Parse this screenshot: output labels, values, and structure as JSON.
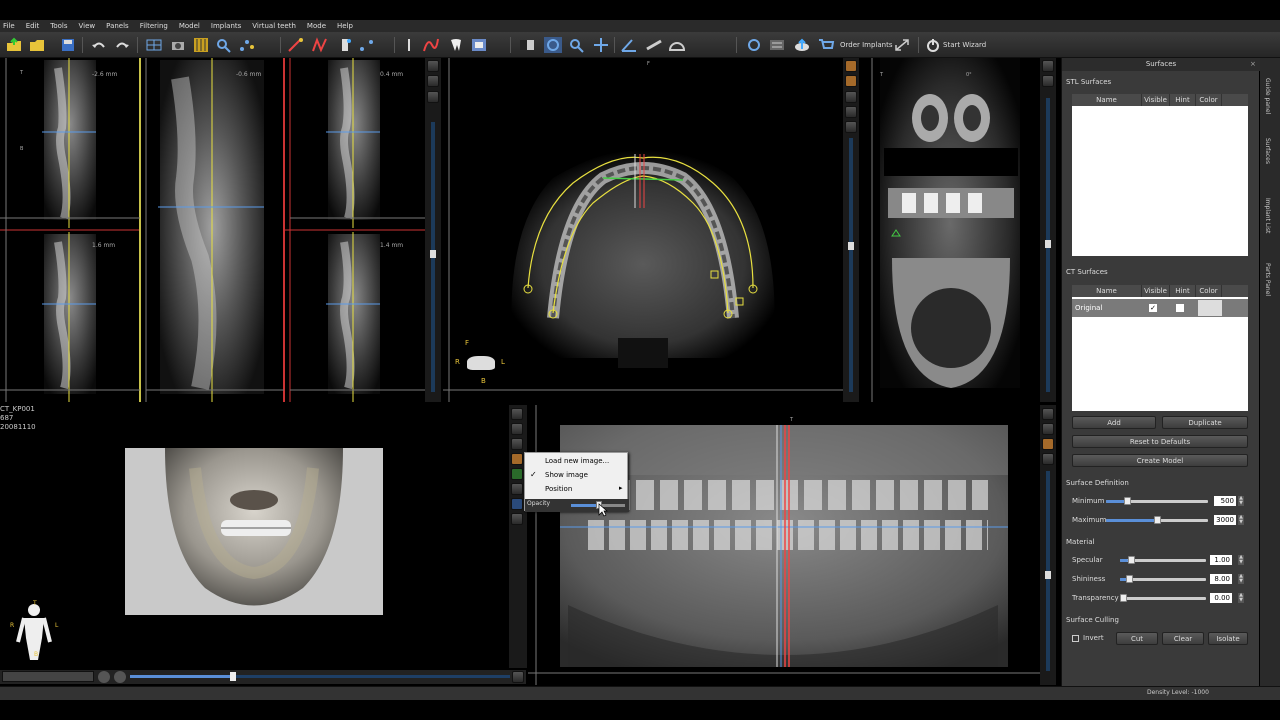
{
  "menu": [
    "File",
    "Edit",
    "Tools",
    "View",
    "Panels",
    "Filtering",
    "Model",
    "Implants",
    "Virtual teeth",
    "Mode",
    "Help"
  ],
  "toolbar": {
    "order_implants": "Order Implants",
    "start_wizard": "Start Wizard"
  },
  "views": {
    "top_left_mm1": "-2.6 mm",
    "top_left_mm2": "-0.6 mm",
    "top_left_mm3": "0.4 mm",
    "bottom_left_mm1": "1.6 mm",
    "bottom_left_mm2": "1.4 mm",
    "axial_label": "F",
    "coronal_deg": "0°",
    "patient_id": "CT_KP001",
    "patient_num": "687",
    "patient_date": "20081110",
    "orient_f": "F",
    "orient_b": "B",
    "orient_r": "R",
    "orient_l": "L",
    "orient_t": "T"
  },
  "context_menu": {
    "load": "Load new image...",
    "show": "Show image",
    "position": "Position",
    "opacity": "Opacity"
  },
  "panel": {
    "title": "Surfaces",
    "stl_label": "STL Surfaces",
    "ct_label": "CT Surfaces",
    "columns": [
      "Name",
      "Visible",
      "Hint",
      "Color"
    ],
    "ct_rows": [
      {
        "name": "Original"
      }
    ],
    "add": "Add",
    "duplicate": "Duplicate",
    "reset": "Reset to Defaults",
    "create": "Create Model",
    "surface_def": "Surface Definition",
    "minimum_label": "Minimum",
    "minimum_value": "500",
    "maximum_label": "Maximum",
    "maximum_value": "3000",
    "material": "Material",
    "specular_label": "Specular",
    "specular_value": "1.00",
    "shininess_label": "Shininess",
    "shininess_value": "8.00",
    "transparency_label": "Transparency",
    "transparency_value": "0.00",
    "culling": "Surface Culling",
    "invert": "Invert",
    "cut": "Cut",
    "clear": "Clear",
    "isolate": "Isolate"
  },
  "side_tabs": [
    "Guide panel",
    "Surfaces",
    "Implant List",
    "Parts Panel"
  ],
  "status": {
    "density": "Density Level: -1000"
  }
}
